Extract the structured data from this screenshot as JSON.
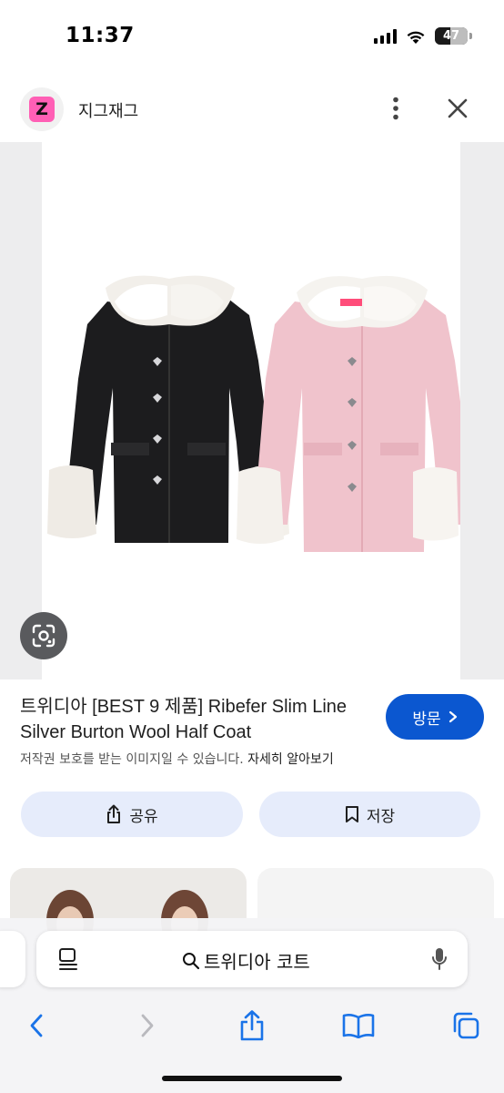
{
  "status_bar": {
    "time": "11:37",
    "battery_percent": "47",
    "battery_level": 0.47,
    "icons": [
      "signal-icon",
      "wifi-icon",
      "battery-icon"
    ]
  },
  "site": {
    "logo_letter": "Z",
    "logo_color": "#ff5fb5",
    "name": "지그재그",
    "more_icon": "more-vert-icon",
    "close_icon": "close-icon"
  },
  "image": {
    "lens_icon": "lens-icon",
    "products": [
      "black coat",
      "pink coat"
    ]
  },
  "product": {
    "title": "트위디아 [BEST 9 제품] Ribefer Slim Line Silver Burton Wool Half Coat",
    "visit_label": "방문",
    "visit_icon": "chevron-right-icon",
    "copyright_text": "저작권 보호를 받는 이미지일 수 있습니다.",
    "learn_more_label": "자세히 알아보기"
  },
  "actions": {
    "share_label": "공유",
    "share_icon": "share-icon",
    "save_label": "저장",
    "save_icon": "bookmark-icon"
  },
  "browser": {
    "address_text": "트위디아 코트",
    "page_menu_icon": "page-menu-icon",
    "search_icon": "search-icon",
    "mic_icon": "mic-icon",
    "nav": [
      "back-icon",
      "forward-icon",
      "share-icon",
      "bookmarks-icon",
      "tabs-icon"
    ]
  },
  "colors": {
    "accent": "#0b57d0",
    "action_bg": "#e6ecfb"
  }
}
